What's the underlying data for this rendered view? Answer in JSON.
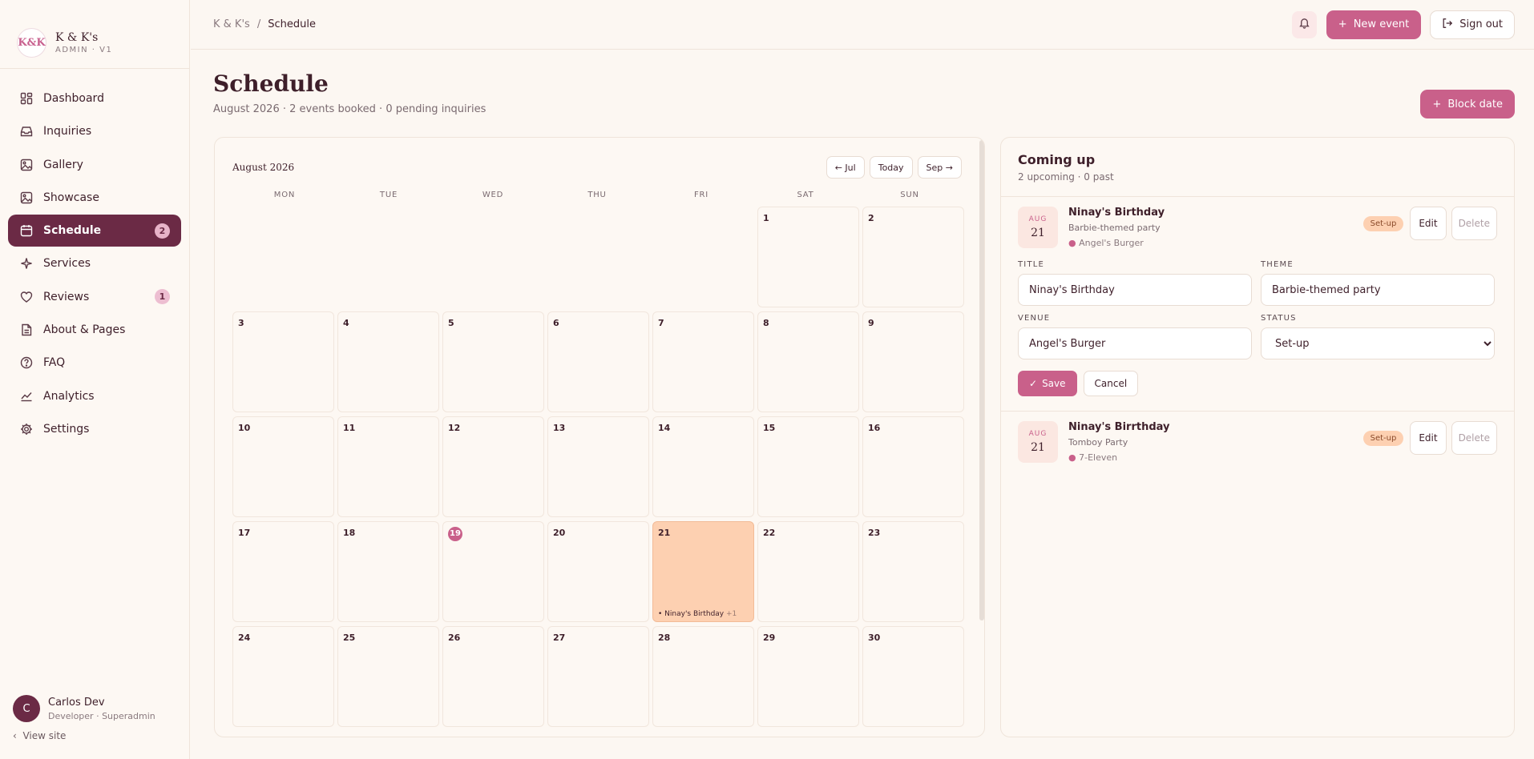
{
  "brand": {
    "logo_text": "K&K",
    "name": "K & K's",
    "subtitle": "ADMIN · V1"
  },
  "sidebar": {
    "items": [
      {
        "label": "Dashboard",
        "icon": "dashboard-icon"
      },
      {
        "label": "Inquiries",
        "icon": "inbox-icon"
      },
      {
        "label": "Gallery",
        "icon": "image-icon"
      },
      {
        "label": "Showcase",
        "icon": "image-icon"
      },
      {
        "label": "Schedule",
        "icon": "calendar-icon",
        "badge": "2",
        "active": true
      },
      {
        "label": "Services",
        "icon": "sparkle-icon"
      },
      {
        "label": "Reviews",
        "icon": "heart-icon",
        "badge": "1"
      },
      {
        "label": "About & Pages",
        "icon": "document-icon"
      },
      {
        "label": "FAQ",
        "icon": "help-circle-icon"
      },
      {
        "label": "Analytics",
        "icon": "chart-line-icon"
      },
      {
        "label": "Settings",
        "icon": "gear-icon"
      }
    ]
  },
  "user": {
    "initial": "C",
    "name": "Carlos Dev",
    "role": "Developer · Superadmin",
    "view_site": "View site"
  },
  "topbar": {
    "breadcrumb_root": "K & K's",
    "breadcrumb_sep": "/",
    "breadcrumb_current": "Schedule",
    "new_event_label": "New event",
    "sign_out_label": "Sign out"
  },
  "page": {
    "title": "Schedule",
    "subtitle": "August 2026 · 2 events booked · 0 pending inquiries",
    "block_date_label": "Block date"
  },
  "calendar": {
    "month_label": "August 2026",
    "prev_label": "← Jul",
    "today_label": "Today",
    "next_label": "Sep →",
    "weekdays": [
      "MON",
      "TUE",
      "WED",
      "THU",
      "FRI",
      "SAT",
      "SUN"
    ],
    "leading_blanks": 5,
    "days_shown": 30,
    "today": 19,
    "event_day": 21,
    "event_preview": "• Ninay's Birthday",
    "event_more": "+1"
  },
  "upcoming": {
    "title": "Coming up",
    "subtitle": "2 upcoming · 0 past",
    "events": [
      {
        "month": "AUG",
        "day": "21",
        "name": "Ninay's Birthday",
        "theme": "Barbie-themed party",
        "venue": "Angel's Burger",
        "status": "Set-up",
        "edit_label": "Edit",
        "delete_label": "Delete"
      },
      {
        "month": "AUG",
        "day": "21",
        "name": "Ninay's Birrthday",
        "theme": "Tomboy Party",
        "venue": "7-Eleven",
        "status": "Set-up",
        "edit_label": "Edit",
        "delete_label": "Delete"
      }
    ],
    "form": {
      "title_label": "TITLE",
      "title_value": "Ninay's Birthday",
      "theme_label": "THEME",
      "theme_value": "Barbie-themed party",
      "venue_label": "VENUE",
      "venue_value": "Angel's Burger",
      "status_label": "STATUS",
      "status_value": "Set-up",
      "save_label": "Save",
      "cancel_label": "Cancel"
    }
  },
  "colors": {
    "accent": "#c9608a",
    "sidebar_active": "#6b2a45",
    "event_fill": "#fdd0b1",
    "background": "#fcf7f2"
  }
}
